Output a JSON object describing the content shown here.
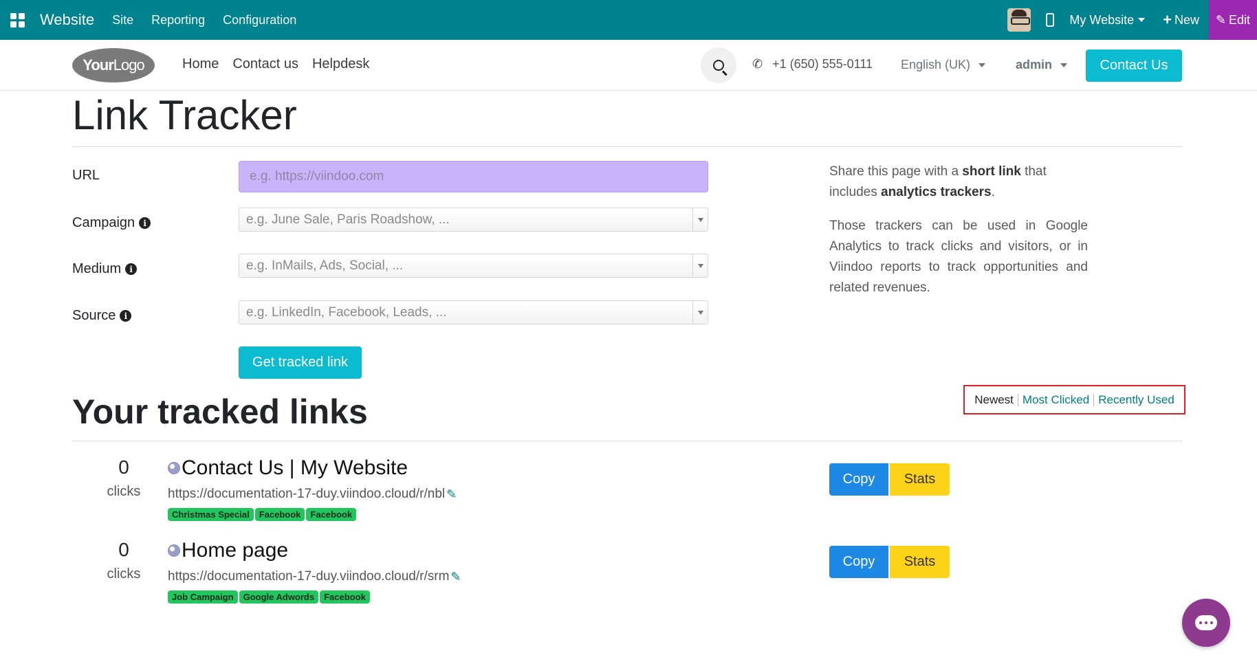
{
  "topbar": {
    "brand": "Website",
    "menus": [
      "Site",
      "Reporting",
      "Configuration"
    ],
    "my_website": "My Website",
    "new_label": "New",
    "edit_label": "Edit"
  },
  "header": {
    "logo_bold": "Your",
    "logo_thin": "Logo",
    "nav": [
      "Home",
      "Contact us",
      "Helpdesk"
    ],
    "phone": "+1 (650) 555-0111",
    "language": "English (UK)",
    "user": "admin",
    "contact_button": "Contact Us"
  },
  "page": {
    "title": "Link Tracker",
    "form": {
      "url_label": "URL",
      "url_placeholder": "e.g. https://viindoo.com",
      "campaign_label": "Campaign",
      "campaign_placeholder": "e.g. June Sale, Paris Roadshow, ...",
      "medium_label": "Medium",
      "medium_placeholder": "e.g. InMails, Ads, Social, ...",
      "source_label": "Source",
      "source_placeholder": "e.g. LinkedIn, Facebook, Leads, ...",
      "submit_label": "Get tracked link"
    },
    "share": {
      "p1_a": "Share this page with a ",
      "p1_b": "short link",
      "p1_c": " that includes ",
      "p1_d": "analytics trackers",
      "p1_e": ".",
      "p2": "Those trackers can be used in Google Analytics to track clicks and visitors, or in Viindoo reports to track opportunities and related revenues."
    },
    "tracked_title": "Your tracked links",
    "sort": {
      "newest": "Newest",
      "most_clicked": "Most Clicked",
      "recently_used": "Recently Used"
    },
    "links": [
      {
        "clicks": "0",
        "clicks_unit": "clicks",
        "title": "Contact Us | My Website",
        "short_url": "https://documentation-17-duy.viindoo.cloud/r/nbl",
        "tags": [
          "Christmas Special",
          "Facebook",
          "Facebook"
        ],
        "copy": "Copy",
        "stats": "Stats"
      },
      {
        "clicks": "0",
        "clicks_unit": "clicks",
        "title": "Home page",
        "short_url": "https://documentation-17-duy.viindoo.cloud/r/srm",
        "tags": [
          "Job Campaign",
          "Google Adwords",
          "Facebook"
        ],
        "copy": "Copy",
        "stats": "Stats"
      }
    ]
  },
  "colors": {
    "topbar": "#00838f",
    "accent": "#0bbcd1",
    "edit": "#9c27b0",
    "copy": "#1e88e5",
    "stats": "#fdd31a",
    "tag": "#22c55e",
    "highlight_box": "#e01f26"
  },
  "icons": {
    "apps": "apps-grid-icon",
    "mobile": "mobile-icon",
    "search": "search-icon",
    "phone": "phone-icon",
    "info": "info-icon",
    "globe": "globe-icon",
    "edit": "pencil-icon",
    "chat": "chat-icon"
  }
}
